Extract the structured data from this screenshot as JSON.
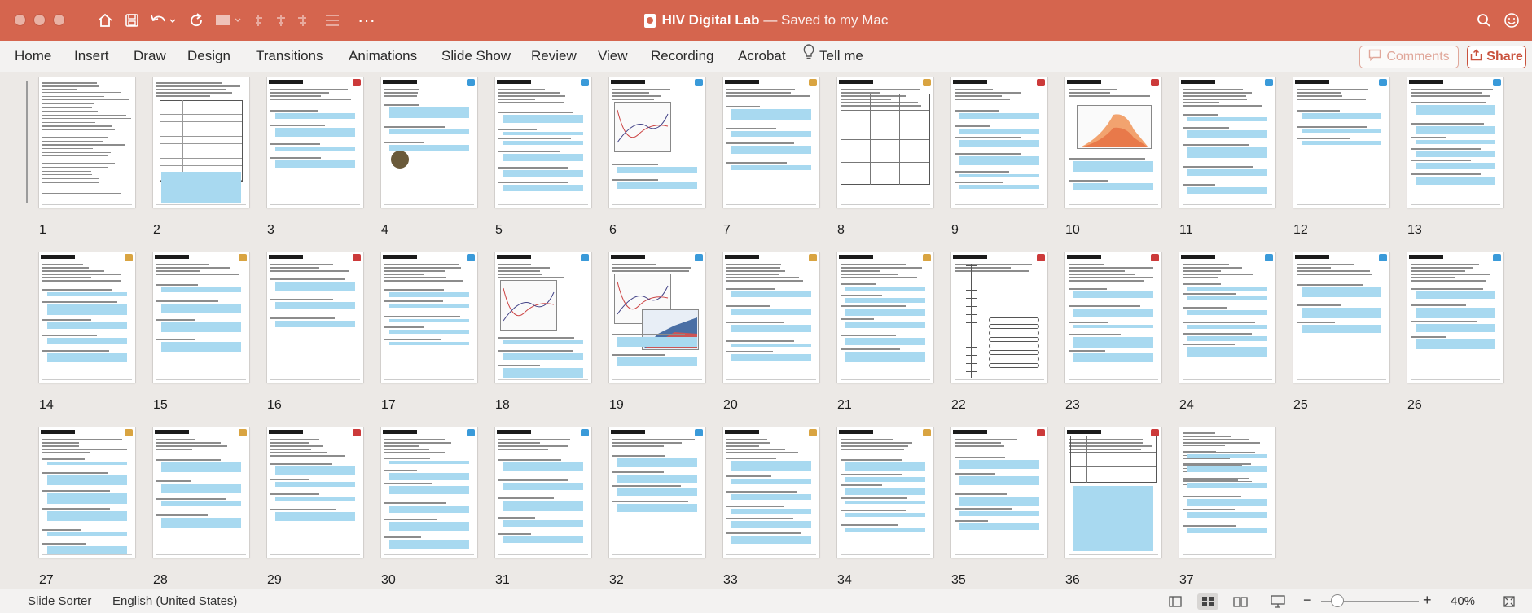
{
  "window": {
    "title": "HIV Digital Lab",
    "subtitle": "— Saved to my Mac"
  },
  "ribbon": {
    "tabs": [
      "Home",
      "Insert",
      "Draw",
      "Design",
      "Transitions",
      "Animations",
      "Slide Show",
      "Review",
      "View",
      "Recording",
      "Acrobat"
    ],
    "tell_me": "Tell me",
    "comments_label": "Comments",
    "share_label": "Share"
  },
  "slides": [
    1,
    2,
    3,
    4,
    5,
    6,
    7,
    8,
    9,
    10,
    11,
    12,
    13,
    14,
    15,
    16,
    17,
    18,
    19,
    20,
    21,
    22,
    23,
    24,
    25,
    26,
    27,
    28,
    29,
    30,
    31,
    32,
    33,
    34,
    35,
    36,
    37
  ],
  "statusbar": {
    "view_name": "Slide Sorter",
    "language": "English (United States)",
    "zoom_minus": "−",
    "zoom_plus": "+",
    "zoom_level": "40%"
  },
  "colors": {
    "title_bar": "#d5654e",
    "answer_box": "#a8d9f0",
    "ribbon_bg": "#f3f2f1",
    "sorter_bg": "#ece9e6"
  },
  "icons": [
    "home-icon",
    "save-icon",
    "undo-icon",
    "redo-icon",
    "present-icon",
    "more-icon",
    "search-icon",
    "smiley-icon",
    "comment-icon",
    "share-icon",
    "lightbulb-icon",
    "normal-view-icon",
    "slide-sorter-icon",
    "reading-view-icon",
    "slideshow-icon",
    "fit-slide-icon"
  ]
}
